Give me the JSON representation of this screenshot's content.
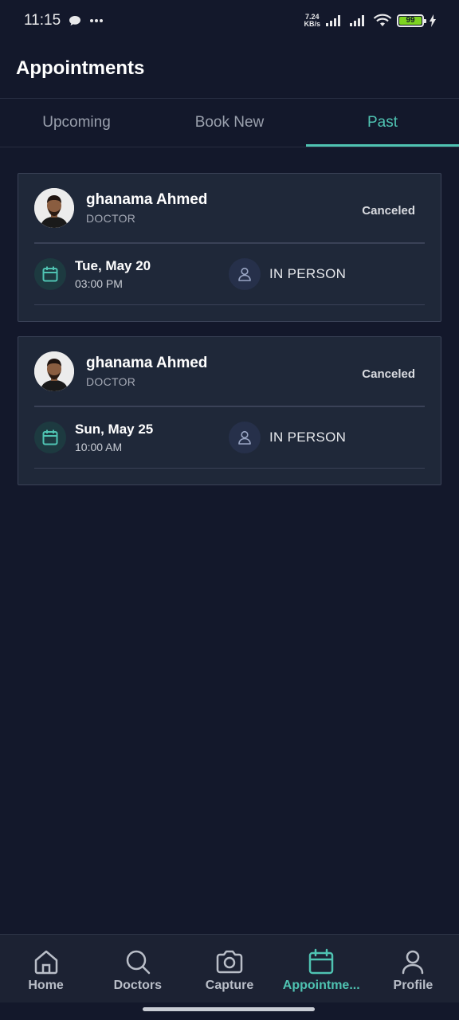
{
  "status_bar": {
    "time": "11:15",
    "net_speed_value": "7.24",
    "net_speed_unit": "KB/s",
    "battery": "99"
  },
  "header": {
    "title": "Appointments"
  },
  "tabs": [
    {
      "label": "Upcoming",
      "active": false
    },
    {
      "label": "Book New",
      "active": false
    },
    {
      "label": "Past",
      "active": true
    }
  ],
  "appointments": [
    {
      "doctor_name": "ghanama Ahmed",
      "role": "DOCTOR",
      "status": "Canceled",
      "date": "Tue, May 20",
      "time": "03:00 PM",
      "visit_type": "IN PERSON"
    },
    {
      "doctor_name": "ghanama Ahmed",
      "role": "DOCTOR",
      "status": "Canceled",
      "date": "Sun, May 25",
      "time": "10:00 AM",
      "visit_type": "IN PERSON"
    }
  ],
  "bottom_nav": [
    {
      "label": "Home",
      "icon": "home-icon"
    },
    {
      "label": "Doctors",
      "icon": "search-icon"
    },
    {
      "label": "Capture",
      "icon": "camera-icon"
    },
    {
      "label": "Appointme...",
      "icon": "calendar-icon",
      "active": true
    },
    {
      "label": "Profile",
      "icon": "person-icon"
    }
  ],
  "colors": {
    "background": "#13182b",
    "accent": "#4fc3b2",
    "card": "#1f2839"
  }
}
